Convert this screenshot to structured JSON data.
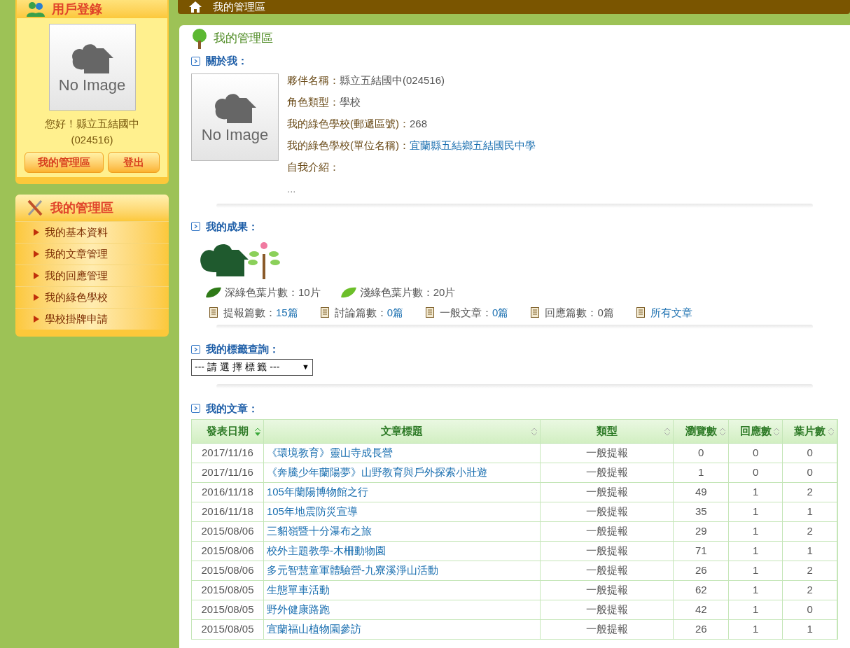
{
  "sidebar": {
    "login": {
      "title": "用戶登錄",
      "avatar_text": "No Image",
      "greeting": "您好！縣立五結國中",
      "code": "(024516)",
      "buttons": [
        "我的管理區",
        "登出"
      ]
    },
    "menu": {
      "title": "我的管理區",
      "items": [
        "我的基本資料",
        "我的文章管理",
        "我的回應管理",
        "我的綠色學校",
        "學校掛牌申請"
      ]
    }
  },
  "breadcrumb": {
    "current": "我的管理區"
  },
  "panel": {
    "title": "我的管理區",
    "about": {
      "heading": "關於我：",
      "avatar_text": "No Image",
      "fields": [
        {
          "label": "夥伴名稱：",
          "value": "縣立五結國中(024516)",
          "link": false
        },
        {
          "label": "角色類型：",
          "value": "學校",
          "link": false
        },
        {
          "label": "我的綠色學校(郵遞區號)：",
          "value": "268",
          "link": false
        },
        {
          "label": "我的綠色學校(單位名稱)：",
          "value": "宜蘭縣五結鄉五結國民中學",
          "link": true
        },
        {
          "label": "自我介紹："
        }
      ],
      "intro": "..."
    },
    "results": {
      "heading": "我的成果：",
      "leaves": [
        {
          "label": "深綠色葉片數：",
          "value": "10片",
          "kind": "dark"
        },
        {
          "label": "淺綠色葉片數：",
          "value": "20片",
          "kind": "light"
        }
      ],
      "counts": [
        {
          "label": "提報篇數：",
          "value": "15篇",
          "link": true
        },
        {
          "label": "討論篇數：",
          "value": "0篇",
          "link": true
        },
        {
          "label": "一般文章：",
          "value": "0篇",
          "link": true
        },
        {
          "label": "回應篇數：",
          "value": "0篇",
          "link": false
        },
        {
          "value": "所有文章",
          "link": true
        }
      ]
    },
    "tags": {
      "heading": "我的標籤查詢：",
      "select": "--- 請 選 擇 標 籤 ---",
      "caret": "▼"
    },
    "articles": {
      "heading": "我的文章：",
      "columns": [
        {
          "label": "發表日期",
          "sorted": true
        },
        {
          "label": "文章標題",
          "sorted": false
        },
        {
          "label": "類型",
          "sorted": false
        },
        {
          "label": "瀏覽數",
          "sorted": false
        },
        {
          "label": "回應數",
          "sorted": false
        },
        {
          "label": "葉片數",
          "sorted": false
        }
      ],
      "rows": [
        [
          "2017/11/16",
          "《環境教育》靈山寺成長營",
          "一般提報",
          "0",
          "0",
          "0"
        ],
        [
          "2017/11/16",
          "《奔騰少年蘭陽夢》山野教育與戶外探索小壯遊",
          "一般提報",
          "1",
          "0",
          "0"
        ],
        [
          "2016/11/18",
          "105年蘭陽博物館之行",
          "一般提報",
          "49",
          "1",
          "2"
        ],
        [
          "2016/11/18",
          "105年地震防災宣導",
          "一般提報",
          "35",
          "1",
          "1"
        ],
        [
          "2015/08/06",
          "三貂嶺暨十分瀑布之旅",
          "一般提報",
          "29",
          "1",
          "2"
        ],
        [
          "2015/08/06",
          "校外主題教學-木柵動物園",
          "一般提報",
          "71",
          "1",
          "1"
        ],
        [
          "2015/08/06",
          "多元智慧童軍體驗營-九寮溪淨山活動",
          "一般提報",
          "26",
          "1",
          "2"
        ],
        [
          "2015/08/05",
          "生態單車活動",
          "一般提報",
          "62",
          "1",
          "2"
        ],
        [
          "2015/08/05",
          "野外健康路跑",
          "一般提報",
          "42",
          "1",
          "0"
        ],
        [
          "2015/08/05",
          "宜蘭福山植物園參訪",
          "一般提報",
          "26",
          "1",
          "1"
        ]
      ]
    }
  }
}
